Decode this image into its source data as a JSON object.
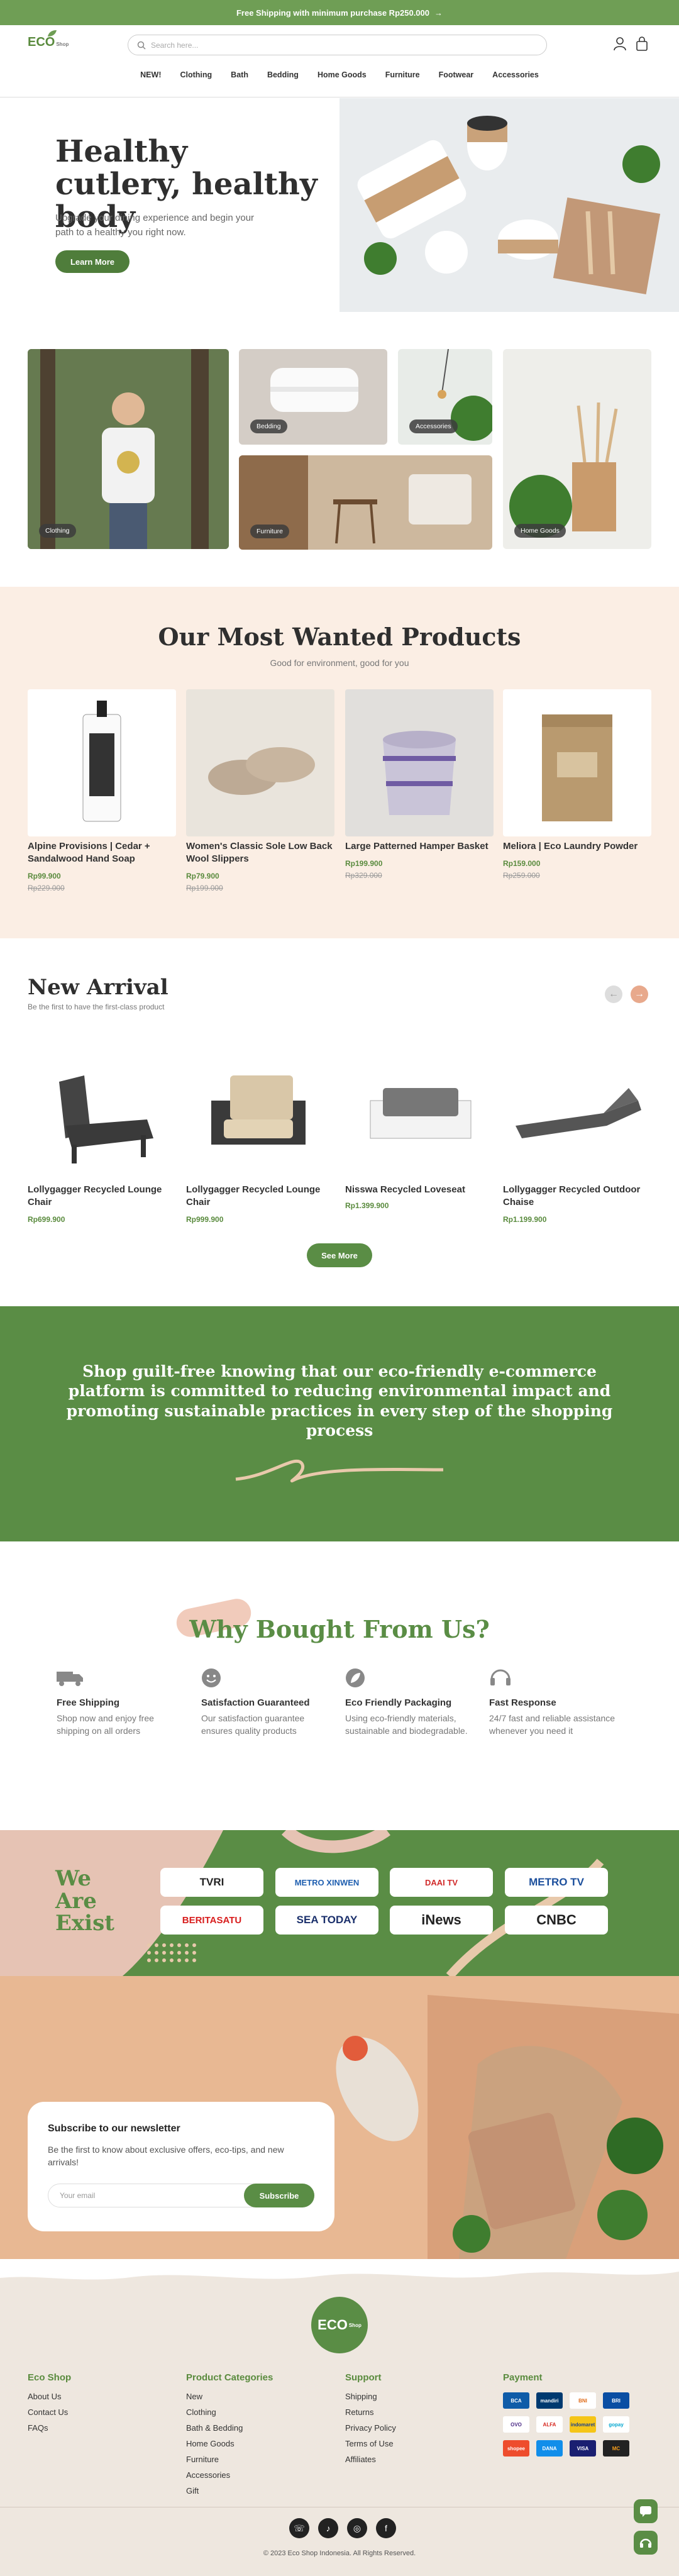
{
  "topbar": {
    "text": "Free Shipping with minimum purchase Rp250.000",
    "arrow": "→"
  },
  "header": {
    "logo": "ECO",
    "logo_sub": "Shop",
    "search_placeholder": "Search here...",
    "nav": [
      "NEW!",
      "Clothing",
      "Bath",
      "Bedding",
      "Home Goods",
      "Furniture",
      "Footwear",
      "Accessories"
    ]
  },
  "hero": {
    "title": "Healthy cutlery, healthy body",
    "subtitle": "Upgrade your dining experience and begin your path to a healthy you right now.",
    "button": "Learn More"
  },
  "categories": [
    "Clothing",
    "Bedding",
    "Accessories",
    "Furniture",
    "Home Goods"
  ],
  "most_wanted": {
    "title": "Our Most Wanted Products",
    "subtitle": "Good for environment, good for you",
    "products": [
      {
        "name": "Alpine Provisions | Cedar + Sandalwood Hand Soap",
        "price": "Rp99.900",
        "old": "Rp229.000"
      },
      {
        "name": "Women's Classic Sole Low Back Wool Slippers",
        "price": "Rp79.900",
        "old": "Rp199.000"
      },
      {
        "name": "Large Patterned Hamper Basket",
        "price": "Rp199.900",
        "old": "Rp329.000"
      },
      {
        "name": "Meliora | Eco Laundry Powder",
        "price": "Rp159.000",
        "old": "Rp259.000"
      }
    ]
  },
  "new_arrival": {
    "title": "New Arrival",
    "subtitle": "Be the first to have the first-class product",
    "button": "See More",
    "products": [
      {
        "name": "Lollygagger Recycled Lounge Chair",
        "price": "Rp699.900"
      },
      {
        "name": "Lollygagger Recycled Lounge Chair",
        "price": "Rp999.900"
      },
      {
        "name": "Nisswa Recycled Loveseat",
        "price": "Rp1.399.900"
      },
      {
        "name": "Lollygagger Recycled Outdoor Chaise",
        "price": "Rp1.199.900"
      }
    ]
  },
  "mission": {
    "text": "Shop guilt-free knowing that our eco-friendly e-commerce platform is committed to reducing environmental impact and promoting sustainable practices in every step of the shopping process"
  },
  "why": {
    "title": "Why Bought From Us?",
    "features": [
      {
        "title": "Free Shipping",
        "text": "Shop now and enjoy free shipping on all orders",
        "icon": "truck-icon"
      },
      {
        "title": "Satisfaction Guaranteed",
        "text": "Our satisfaction guarantee ensures quality products",
        "icon": "smile-icon"
      },
      {
        "title": "Eco Friendly Packaging",
        "text": "Using eco-friendly materials, sustainable and biodegradable.",
        "icon": "leaf-icon"
      },
      {
        "title": "Fast Response",
        "text": "24/7 fast and reliable assistance whenever you need it",
        "icon": "headset-icon"
      }
    ]
  },
  "press": {
    "title": "We Are Exist",
    "logos": [
      "TVRI",
      "METRO XINWEN",
      "DAAI TV",
      "METRO TV",
      "BERITASATU",
      "SEA TODAY",
      "iNews",
      "CNBC"
    ]
  },
  "newsletter": {
    "title": "Subscribe to our newsletter",
    "text": "Be the first to know about exclusive offers, eco-tips, and new arrivals!",
    "placeholder": "Your email",
    "button": "Subscribe"
  },
  "footer": {
    "logo": "ECO",
    "logo_sub": "Shop",
    "cols": [
      {
        "title": "Eco Shop",
        "items": [
          "About Us",
          "Contact Us",
          "FAQs"
        ]
      },
      {
        "title": "Product Categories",
        "items": [
          "New",
          "Clothing",
          "Bath & Bedding",
          "Home Goods",
          "Furniture",
          "Accessories",
          "Gift"
        ]
      },
      {
        "title": "Support",
        "items": [
          "Shipping",
          "Returns",
          "Privacy Policy",
          "Terms of Use",
          "Affiliates"
        ]
      }
    ],
    "payment_title": "Payment",
    "payments": [
      "BCA",
      "mandiri",
      "BNI",
      "BRI",
      "OVO",
      "ALFA",
      "indomaret",
      "gopay",
      "shopee",
      "DANA",
      "VISA",
      "MC"
    ],
    "copyright": "© 2023 Eco Shop Indonesia. All Rights Reserved."
  },
  "colors": {
    "brand": "#5a8b3e",
    "peach": "#fbeee4"
  }
}
